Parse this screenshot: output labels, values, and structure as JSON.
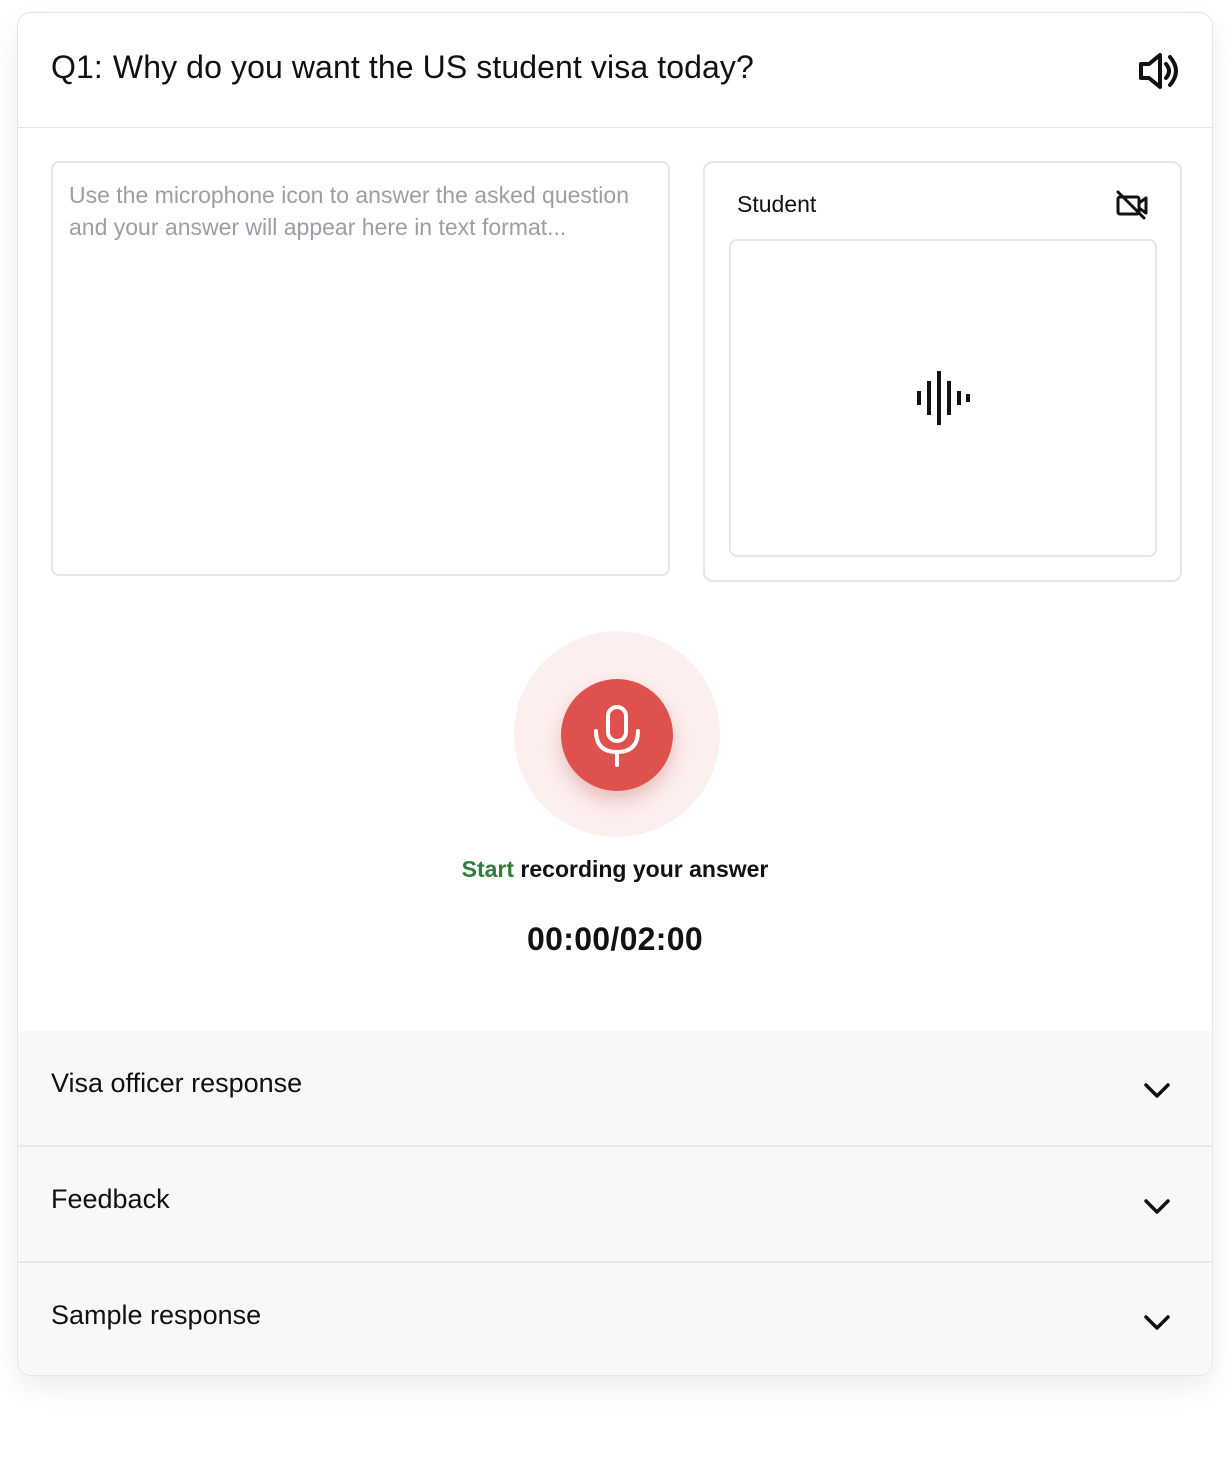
{
  "question": {
    "number": "Q1:",
    "text": "Why do you want the US student visa today?",
    "audio_icon": "speaker-icon"
  },
  "answer": {
    "placeholder": "Use the microphone icon to answer the asked question and your answer will appear here in text format..."
  },
  "student_panel": {
    "label": "Student",
    "camera_icon": "video-off-icon",
    "preview_icon": "waveform-icon"
  },
  "recorder": {
    "mic_icon": "microphone-icon",
    "start_word": "Start",
    "rest_text": " recording your answer",
    "timer": "00:00/02:00"
  },
  "accordions": [
    {
      "label": "Visa officer response",
      "icon": "chevron-down-icon"
    },
    {
      "label": "Feedback",
      "icon": "chevron-down-icon"
    },
    {
      "label": "Sample response",
      "icon": "chevron-down-icon"
    }
  ],
  "colors": {
    "mic_red": "#de514c",
    "mic_halo": "#fcefee",
    "start_green": "#2e7d3a",
    "accordion_bg": "#f7f8fa",
    "border": "#e3e5e8",
    "placeholder_gray": "#9a9fa6"
  }
}
